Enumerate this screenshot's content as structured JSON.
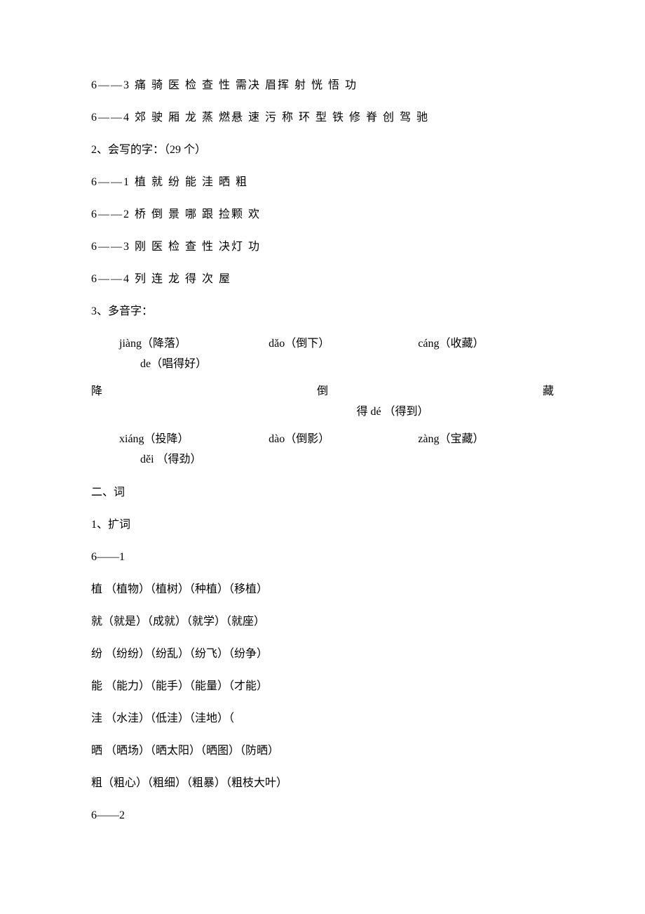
{
  "lines": {
    "l1": "6——3 痛 骑 医 检 查 性 需决 眉挥 射 恍 悟 功",
    "l2": "6——4 郊 驶 厢 龙 蒸 燃悬 速 污 称 环 型 铁 修 脊 创 驾 驰",
    "l3": "2、会写的字：（29 个）",
    "l4": "6——1 植 就 纷 能 洼 晒 粗",
    "l5": "6——2 桥 倒 景 哪 跟 捡颗 欢",
    "l6": "6——3 刚 医 检 查 性 决灯 功",
    "l7": "6——4 列 连 龙 得 次 屋",
    "l8": "3、多音字：",
    "l9": "二、词",
    "l10": "1、扩词",
    "l11": "6——1",
    "l12": "植 （植物）（植树）（种植）（移植）",
    "l13": "就（就是）（成就）（就学）（就座）",
    "l14": "纷 （纷纷）（纷乱）（纷飞）（纷争）",
    "l15": "能 （能力）（能手）（能量）（才能）",
    "l16": "洼 （水洼）（低洼）（洼地）（",
    "l17": "晒 （晒场）（晒太阳）（晒图）（防晒）",
    "l18": "粗（粗心）（粗细）（粗暴）（粗枝大叶）",
    "l19": "6——2"
  },
  "poly": {
    "r1c1": "jiàng（降落）",
    "r1c2": "dǎo（倒下）",
    "r1c3": "cáng（收藏）",
    "r1b": "de（唱得好）",
    "r2a": "降",
    "r2b": "倒",
    "r2c": "藏",
    "r2d": "得 dé （得到）",
    "r3c1": "xiáng（投降）",
    "r3c2": "dào（倒影）",
    "r3c3": "zàng（宝藏）",
    "r3b": "děi （得劲）"
  }
}
